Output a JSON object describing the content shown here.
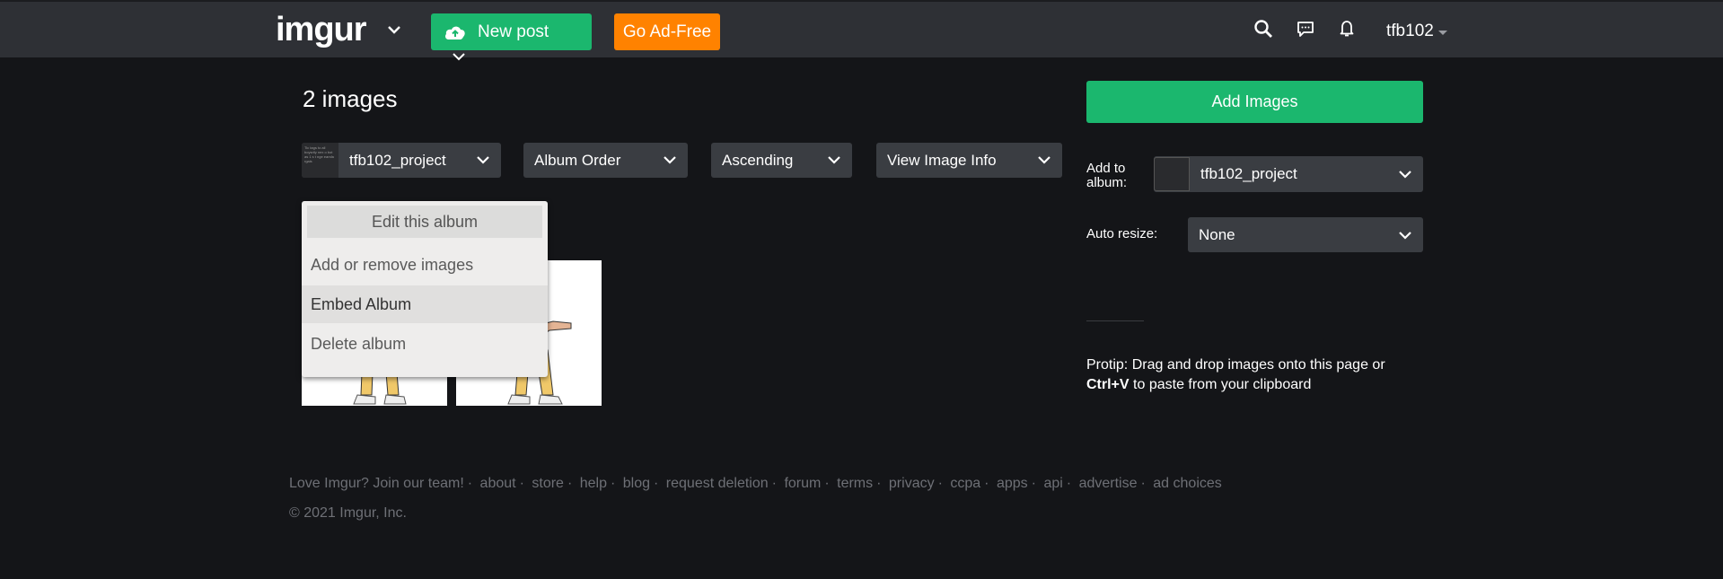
{
  "header": {
    "logo_text": "imgur",
    "new_post_label": "New post",
    "ad_free_label": "Go Ad-Free",
    "username": "tfb102",
    "icons": [
      "search-icon",
      "chat-icon",
      "bell-icon"
    ],
    "accent_green": "#1bb76e",
    "accent_orange": "#ff8200"
  },
  "main": {
    "images_count": "2 images",
    "album_select": {
      "value": "tfb102_project",
      "thumb_text": "Tic tags to all boysrtly nex o bot as 1 s t nge earsfa rgais"
    },
    "order_select": {
      "value": "Album Order"
    },
    "direction_select": {
      "value": "Ascending"
    },
    "view_select": {
      "value": "View Image Info"
    },
    "context_menu": {
      "header": "Edit this album",
      "items": [
        "Add or remove images",
        "Embed Album",
        "Delete album"
      ]
    }
  },
  "sidebar": {
    "add_images_label": "Add Images",
    "add_to_album_label": "Add to album:",
    "add_to_album_value": "tfb102_project",
    "auto_resize_label": "Auto resize:",
    "auto_resize_value": "None",
    "protip_text": "Protip: Drag and drop images onto this page or",
    "protip_key": "Ctrl+V",
    "protip_tail": "to paste from your clipboard"
  },
  "footer": {
    "links": [
      "Love Imgur? Join our team!",
      "about",
      "store",
      "help",
      "blog",
      "request deletion",
      "forum",
      "terms",
      "privacy",
      "ccpa",
      "apps",
      "api",
      "advertise",
      "ad choices"
    ],
    "copyright": "© 2021 Imgur, Inc."
  }
}
